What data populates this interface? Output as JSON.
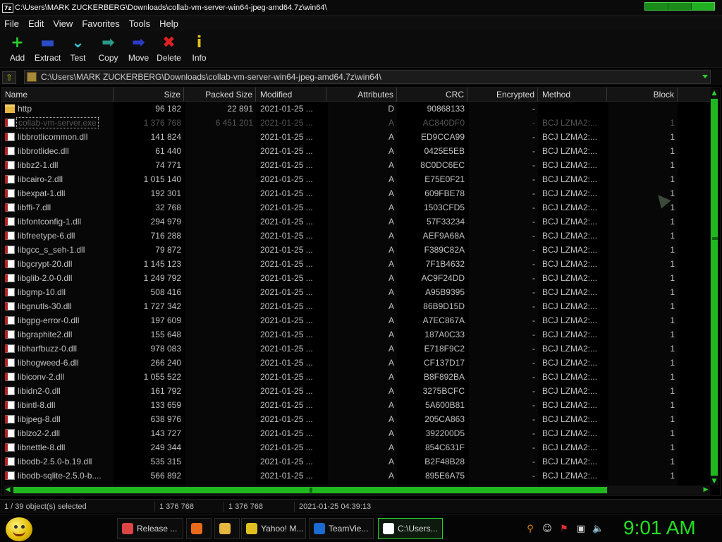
{
  "window": {
    "title": "C:\\Users\\MARK ZUCKERBERG\\Downloads\\collab-vm-server-win64-jpeg-amd64.7z\\win64\\",
    "app_icon_text": "7z"
  },
  "menu": [
    "File",
    "Edit",
    "View",
    "Favorites",
    "Tools",
    "Help"
  ],
  "toolbar": [
    {
      "label": "Add",
      "icon": "plus-icon",
      "glyph": "+",
      "color": "#2ad12a"
    },
    {
      "label": "Extract",
      "icon": "minus-icon",
      "glyph": "▬",
      "color": "#2a4cc8"
    },
    {
      "label": "Test",
      "icon": "check-down-icon",
      "glyph": "⌄",
      "color": "#35c8d8"
    },
    {
      "label": "Copy",
      "icon": "copy-arrow-icon",
      "glyph": "➡",
      "color": "#2a9a8a"
    },
    {
      "label": "Move",
      "icon": "move-arrow-icon",
      "glyph": "➡",
      "color": "#2a3ac8"
    },
    {
      "label": "Delete",
      "icon": "delete-x-icon",
      "glyph": "✖",
      "color": "#e02020"
    },
    {
      "label": "Info",
      "icon": "info-icon",
      "glyph": "i",
      "color": "#e0c020"
    }
  ],
  "address": {
    "path": "C:\\Users\\MARK ZUCKERBERG\\Downloads\\collab-vm-server-win64-jpeg-amd64.7z\\win64\\"
  },
  "columns": [
    "Name",
    "Size",
    "Packed Size",
    "Modified",
    "Attributes",
    "CRC",
    "Encrypted",
    "Method",
    "Block"
  ],
  "rows": [
    {
      "name": "http",
      "type": "folder",
      "size": "96 182",
      "packed": "22 891",
      "modified": "2021-01-25 ...",
      "attr": "D",
      "crc": "90868133",
      "enc": "-",
      "method": "",
      "block": ""
    },
    {
      "name": "collab-vm-server.exe",
      "type": "file",
      "size": "1 376 768",
      "packed": "6 451 201",
      "modified": "2021-01-25 ...",
      "attr": "A",
      "crc": "AC840DF0",
      "enc": "-",
      "method": "BCJ LZMA2:...",
      "block": "1",
      "selected": true
    },
    {
      "name": "libbrotlicommon.dll",
      "type": "file",
      "size": "141 824",
      "packed": "",
      "modified": "2021-01-25 ...",
      "attr": "A",
      "crc": "ED9CCA99",
      "enc": "-",
      "method": "BCJ LZMA2:...",
      "block": "1"
    },
    {
      "name": "libbrotlidec.dll",
      "type": "file",
      "size": "61 440",
      "packed": "",
      "modified": "2021-01-25 ...",
      "attr": "A",
      "crc": "0425E5EB",
      "enc": "-",
      "method": "BCJ LZMA2:...",
      "block": "1"
    },
    {
      "name": "libbz2-1.dll",
      "type": "file",
      "size": "74 771",
      "packed": "",
      "modified": "2021-01-25 ...",
      "attr": "A",
      "crc": "8C0DC6EC",
      "enc": "-",
      "method": "BCJ LZMA2:...",
      "block": "1"
    },
    {
      "name": "libcairo-2.dll",
      "type": "file",
      "size": "1 015 140",
      "packed": "",
      "modified": "2021-01-25 ...",
      "attr": "A",
      "crc": "E75E0F21",
      "enc": "-",
      "method": "BCJ LZMA2:...",
      "block": "1"
    },
    {
      "name": "libexpat-1.dll",
      "type": "file",
      "size": "192 301",
      "packed": "",
      "modified": "2021-01-25 ...",
      "attr": "A",
      "crc": "609FBE78",
      "enc": "-",
      "method": "BCJ LZMA2:...",
      "block": "1"
    },
    {
      "name": "libffi-7.dll",
      "type": "file",
      "size": "32 768",
      "packed": "",
      "modified": "2021-01-25 ...",
      "attr": "A",
      "crc": "1503CFD5",
      "enc": "-",
      "method": "BCJ LZMA2:...",
      "block": "1"
    },
    {
      "name": "libfontconfig-1.dll",
      "type": "file",
      "size": "294 979",
      "packed": "",
      "modified": "2021-01-25 ...",
      "attr": "A",
      "crc": "57F33234",
      "enc": "-",
      "method": "BCJ LZMA2:...",
      "block": "1"
    },
    {
      "name": "libfreetype-6.dll",
      "type": "file",
      "size": "716 288",
      "packed": "",
      "modified": "2021-01-25 ...",
      "attr": "A",
      "crc": "AEF9A68A",
      "enc": "-",
      "method": "BCJ LZMA2:...",
      "block": "1"
    },
    {
      "name": "libgcc_s_seh-1.dll",
      "type": "file",
      "size": "79 872",
      "packed": "",
      "modified": "2021-01-25 ...",
      "attr": "A",
      "crc": "F389C82A",
      "enc": "-",
      "method": "BCJ LZMA2:...",
      "block": "1"
    },
    {
      "name": "libgcrypt-20.dll",
      "type": "file",
      "size": "1 145 123",
      "packed": "",
      "modified": "2021-01-25 ...",
      "attr": "A",
      "crc": "7F1B4632",
      "enc": "-",
      "method": "BCJ LZMA2:...",
      "block": "1"
    },
    {
      "name": "libglib-2.0-0.dll",
      "type": "file",
      "size": "1 249 792",
      "packed": "",
      "modified": "2021-01-25 ...",
      "attr": "A",
      "crc": "AC9F24DD",
      "enc": "-",
      "method": "BCJ LZMA2:...",
      "block": "1"
    },
    {
      "name": "libgmp-10.dll",
      "type": "file",
      "size": "508 416",
      "packed": "",
      "modified": "2021-01-25 ...",
      "attr": "A",
      "crc": "A95B9395",
      "enc": "-",
      "method": "BCJ LZMA2:...",
      "block": "1"
    },
    {
      "name": "libgnutls-30.dll",
      "type": "file",
      "size": "1 727 342",
      "packed": "",
      "modified": "2021-01-25 ...",
      "attr": "A",
      "crc": "86B9D15D",
      "enc": "-",
      "method": "BCJ LZMA2:...",
      "block": "1"
    },
    {
      "name": "libgpg-error-0.dll",
      "type": "file",
      "size": "197 609",
      "packed": "",
      "modified": "2021-01-25 ...",
      "attr": "A",
      "crc": "A7EC867A",
      "enc": "-",
      "method": "BCJ LZMA2:...",
      "block": "1"
    },
    {
      "name": "libgraphite2.dll",
      "type": "file",
      "size": "155 648",
      "packed": "",
      "modified": "2021-01-25 ...",
      "attr": "A",
      "crc": "187A0C33",
      "enc": "-",
      "method": "BCJ LZMA2:...",
      "block": "1"
    },
    {
      "name": "libharfbuzz-0.dll",
      "type": "file",
      "size": "978 083",
      "packed": "",
      "modified": "2021-01-25 ...",
      "attr": "A",
      "crc": "E718F9C2",
      "enc": "-",
      "method": "BCJ LZMA2:...",
      "block": "1"
    },
    {
      "name": "libhogweed-6.dll",
      "type": "file",
      "size": "266 240",
      "packed": "",
      "modified": "2021-01-25 ...",
      "attr": "A",
      "crc": "CF137D17",
      "enc": "-",
      "method": "BCJ LZMA2:...",
      "block": "1"
    },
    {
      "name": "libiconv-2.dll",
      "type": "file",
      "size": "1 055 522",
      "packed": "",
      "modified": "2021-01-25 ...",
      "attr": "A",
      "crc": "B8F892BA",
      "enc": "-",
      "method": "BCJ LZMA2:...",
      "block": "1"
    },
    {
      "name": "libidn2-0.dll",
      "type": "file",
      "size": "161 792",
      "packed": "",
      "modified": "2021-01-25 ...",
      "attr": "A",
      "crc": "3275BCFC",
      "enc": "-",
      "method": "BCJ LZMA2:...",
      "block": "1"
    },
    {
      "name": "libintl-8.dll",
      "type": "file",
      "size": "133 659",
      "packed": "",
      "modified": "2021-01-25 ...",
      "attr": "A",
      "crc": "5A600B81",
      "enc": "-",
      "method": "BCJ LZMA2:...",
      "block": "1"
    },
    {
      "name": "libjpeg-8.dll",
      "type": "file",
      "size": "638 976",
      "packed": "",
      "modified": "2021-01-25 ...",
      "attr": "A",
      "crc": "205CA863",
      "enc": "-",
      "method": "BCJ LZMA2:...",
      "block": "1"
    },
    {
      "name": "liblzo2-2.dll",
      "type": "file",
      "size": "143 727",
      "packed": "",
      "modified": "2021-01-25 ...",
      "attr": "A",
      "crc": "392200D5",
      "enc": "-",
      "method": "BCJ LZMA2:...",
      "block": "1"
    },
    {
      "name": "libnettle-8.dll",
      "type": "file",
      "size": "249 344",
      "packed": "",
      "modified": "2021-01-25 ...",
      "attr": "A",
      "crc": "854C631F",
      "enc": "-",
      "method": "BCJ LZMA2:...",
      "block": "1"
    },
    {
      "name": "libodb-2.5.0-b.19.dll",
      "type": "file",
      "size": "535 315",
      "packed": "",
      "modified": "2021-01-25 ...",
      "attr": "A",
      "crc": "B2F48B28",
      "enc": "-",
      "method": "BCJ LZMA2:...",
      "block": "1"
    },
    {
      "name": "libodb-sqlite-2.5.0-b....",
      "type": "file",
      "size": "566 892",
      "packed": "",
      "modified": "2021-01-25 ...",
      "attr": "A",
      "crc": "895E6A75",
      "enc": "-",
      "method": "BCJ LZMA2:...",
      "block": "1"
    }
  ],
  "status": {
    "selection": "1 / 39 object(s) selected",
    "size": "1 376 768",
    "packed": "1 376 768",
    "modified": "2021-01-25 04:39:13"
  },
  "taskbar": {
    "tasks": [
      {
        "label": "Release ...",
        "icon": "chrome-icon",
        "color": "#d44"
      },
      {
        "label": "",
        "icon": "firefox-icon",
        "color": "#e86a1a"
      },
      {
        "label": "",
        "icon": "folder-icon",
        "color": "#e5b640"
      },
      {
        "label": "Yahoo! M...",
        "icon": "yahoo-messenger-icon",
        "color": "#e0c020"
      },
      {
        "label": "TeamVie...",
        "icon": "teamviewer-icon",
        "color": "#1a6ad0"
      },
      {
        "label": "C:\\Users...",
        "icon": "7zip-icon",
        "color": "#ffffff",
        "active": true
      }
    ],
    "clock": "9:01 AM"
  },
  "colors": {
    "accent": "#22d022",
    "background": "#000000"
  }
}
